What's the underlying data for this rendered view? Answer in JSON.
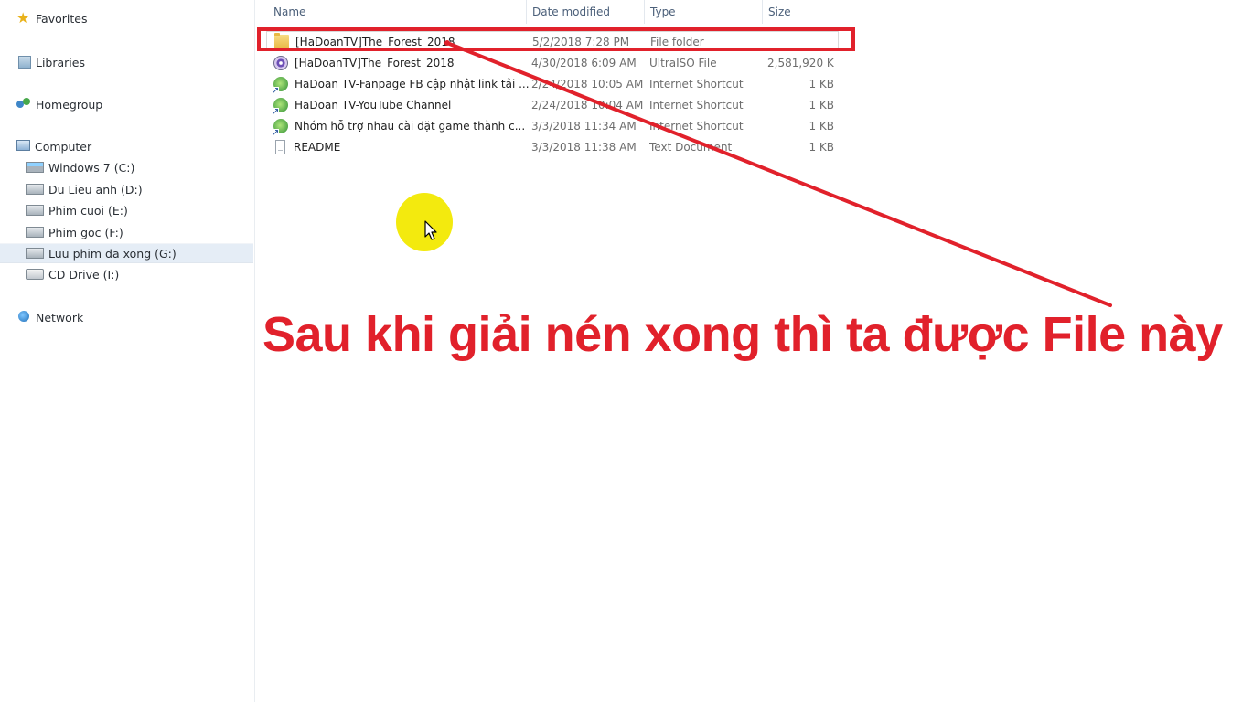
{
  "sidebar": {
    "favorites": "Favorites",
    "libraries": "Libraries",
    "homegroup": "Homegroup",
    "computer": "Computer",
    "drives": [
      {
        "label": "Windows 7 (C:)",
        "icon": "windows-drive-icon"
      },
      {
        "label": "Du Lieu anh (D:)",
        "icon": "hard-drive-icon"
      },
      {
        "label": "Phim cuoi (E:)",
        "icon": "hard-drive-icon"
      },
      {
        "label": "Phim goc (F:)",
        "icon": "hard-drive-icon"
      },
      {
        "label": "Luu phim da xong (G:)",
        "icon": "hard-drive-icon",
        "selected": true
      },
      {
        "label": "CD Drive (I:)",
        "icon": "cd-drive-icon"
      }
    ],
    "network": "Network"
  },
  "columns": {
    "name": "Name",
    "date": "Date modified",
    "type": "Type",
    "size": "Size"
  },
  "files": [
    {
      "name": "[HaDoanTV]The_Forest_2018",
      "date": "5/2/2018 7:28 PM",
      "type": "File folder",
      "size": "",
      "icon": "folder-icon"
    },
    {
      "name": "[HaDoanTV]The_Forest_2018",
      "date": "4/30/2018 6:09 AM",
      "type": "UltraISO File",
      "size": "2,581,920 KB",
      "icon": "iso-file-icon"
    },
    {
      "name": "HaDoan TV-Fanpage FB cập nhật link tải ...",
      "date": "2/24/2018 10:05 AM",
      "type": "Internet Shortcut",
      "size": "1 KB",
      "icon": "internet-shortcut-icon"
    },
    {
      "name": "HaDoan TV-YouTube Channel",
      "date": "2/24/2018 10:04 AM",
      "type": "Internet Shortcut",
      "size": "1 KB",
      "icon": "internet-shortcut-icon"
    },
    {
      "name": "Nhóm hỗ trợ nhau cài đặt game thành c...",
      "date": "3/3/2018 11:34 AM",
      "type": "Internet Shortcut",
      "size": "1 KB",
      "icon": "internet-shortcut-icon"
    },
    {
      "name": "README",
      "date": "3/3/2018 11:38 AM",
      "type": "Text Document",
      "size": "1 KB",
      "icon": "text-document-icon"
    }
  ],
  "annotation": {
    "caption": "Sau khi giải nén xong thì ta được File này",
    "color": "#e1212b",
    "cursor_highlight_color": "#f3ea0e"
  }
}
